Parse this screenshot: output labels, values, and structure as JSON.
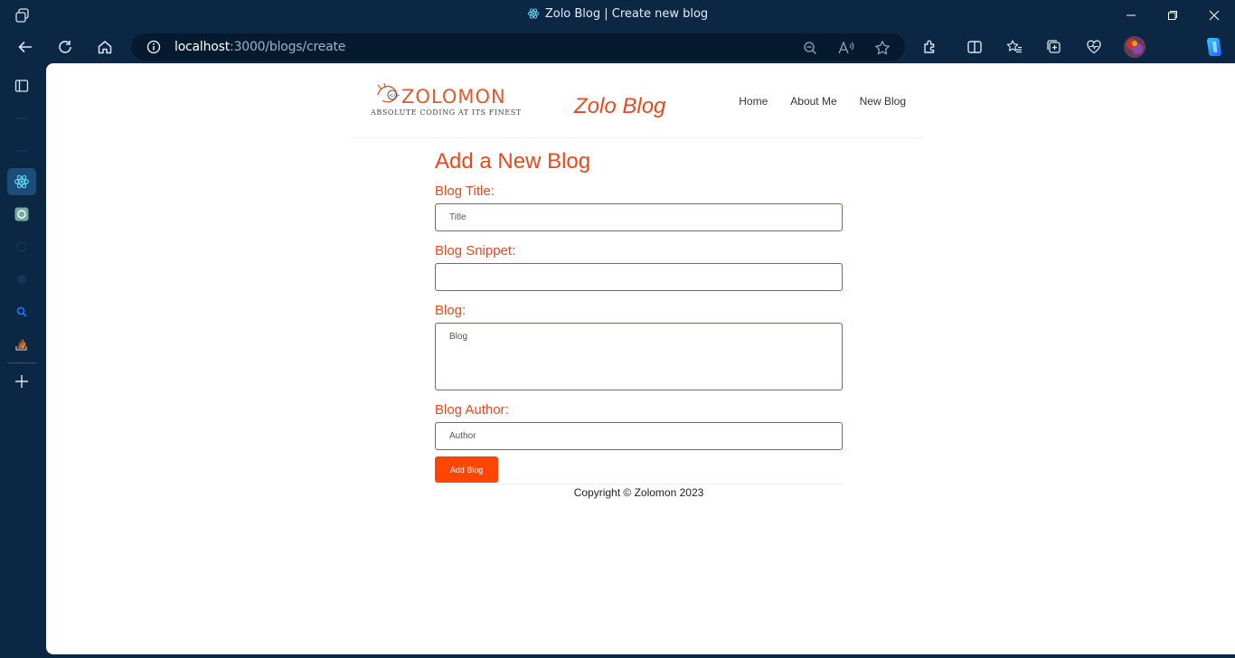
{
  "window": {
    "tab_title": "Zolo Blog | Create new blog"
  },
  "address_bar": {
    "host": "localhost",
    "path": ":3000/blogs/create"
  },
  "icons": {
    "workspaces": "workspaces-icon",
    "back": "back-arrow-icon",
    "refresh": "refresh-icon",
    "home": "home-icon",
    "info": "site-info-icon",
    "zoom": "zoom-out-icon",
    "read_aloud": "read-aloud-icon",
    "favorite": "favorite-star-icon",
    "extensions": "extensions-icon",
    "split": "split-screen-icon",
    "favorites": "favorites-icon",
    "collections": "collections-icon",
    "performance": "browser-essentials-icon",
    "profile": "profile-avatar",
    "menu": "more-menu-icon",
    "copilot": "copilot-icon"
  },
  "site": {
    "logo_word": "ZOLOMON",
    "logo_tagline": "ABSOLUTE CODING AT ITS FINEST",
    "title": "Zolo Blog",
    "nav": [
      "Home",
      "About Me",
      "New Blog"
    ]
  },
  "form": {
    "heading": "Add a New Blog",
    "title_label": "Blog Title:",
    "title_placeholder": "Title",
    "snippet_label": "Blog Snippet:",
    "snippet_placeholder": "",
    "body_label": "Blog:",
    "body_placeholder": "Blog",
    "author_label": "Blog Author:",
    "author_placeholder": "Author",
    "submit_label": "Add Blog"
  },
  "footer": {
    "copyright": "Copyright © Zolomon 2023"
  },
  "colors": {
    "accent": "#e8491d",
    "button": "#ff4500",
    "chrome": "#0b2744"
  }
}
